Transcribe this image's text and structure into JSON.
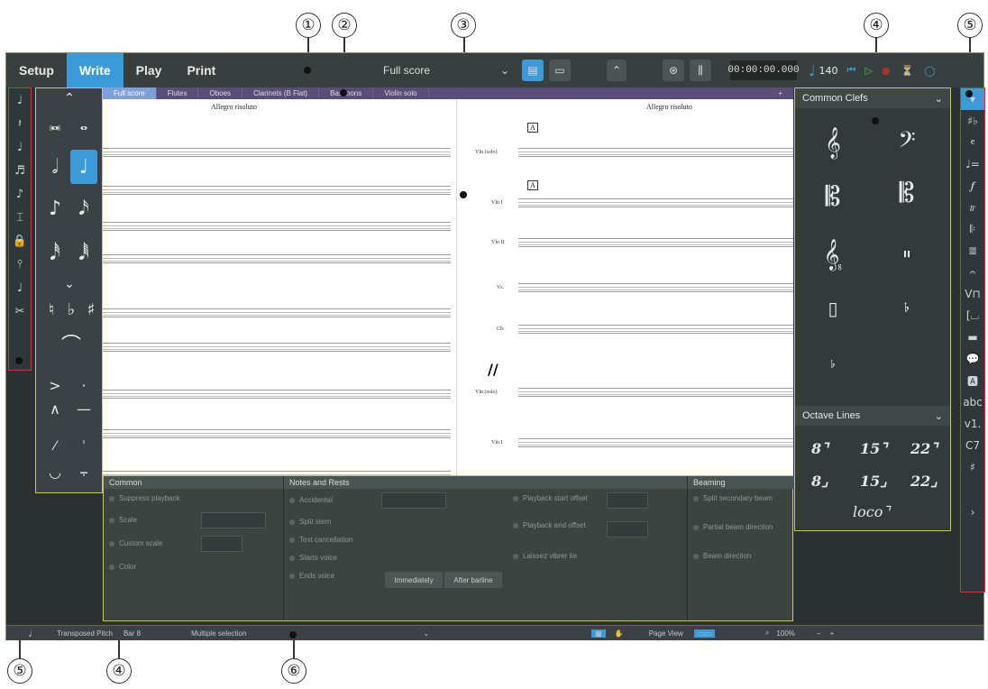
{
  "callouts": [
    "①",
    "②",
    "③",
    "④",
    "⑤",
    "⑤",
    "④",
    "⑥"
  ],
  "toolbar": {
    "modes": [
      "Setup",
      "Write",
      "Play",
      "Print"
    ],
    "layout": "Full score",
    "timecode": "00:00:00.000",
    "tempo": "140"
  },
  "tabs": [
    "Full score",
    "Flutes",
    "Oboes",
    "Clarinets (B Flat)",
    "Bassoons",
    "Violin solo"
  ],
  "score": {
    "tempo_left": "Allegro risoluto",
    "tempo_right": "Allegro risoluto",
    "rehearsal": "A",
    "instruments_right": [
      "Vln (solo)",
      "Vln I",
      "Vln II",
      "Vc.",
      "Cb.",
      "Vln (solo)",
      "Vln I"
    ]
  },
  "properties": {
    "common": {
      "title": "Common",
      "rows": [
        "Suppress playback",
        "Scale",
        "Custom scale",
        "Color"
      ]
    },
    "notes": {
      "title": "Notes and Rests",
      "rows": [
        "Accidental",
        "Split stem",
        "Text cancellation",
        "Starts voice",
        "Ends voice"
      ],
      "right_rows": [
        "Playback start offset",
        "Playback end offset",
        "Laissez vibrer tie"
      ],
      "btn_immediately": "Immediately",
      "btn_after": "After barline"
    },
    "beaming": {
      "title": "Beaming",
      "rows": [
        "Split secondary beam",
        "Partial beam direction",
        "Beam direction"
      ]
    }
  },
  "panel": {
    "clefs_title": "Common Clefs",
    "octave_title": "Octave Lines",
    "octaves": [
      "8⌝",
      "15⌝",
      "22⌝",
      "8⌟",
      "15⌟",
      "22⌟"
    ],
    "loco": "loco⌝"
  },
  "status": {
    "pitch": "Transposed Pitch",
    "bar": "Bar 8",
    "selection": "Multiple selection",
    "view": "Page View",
    "zoom": "100%"
  },
  "right_icons": [
    "abc",
    "v1.",
    "C7"
  ]
}
